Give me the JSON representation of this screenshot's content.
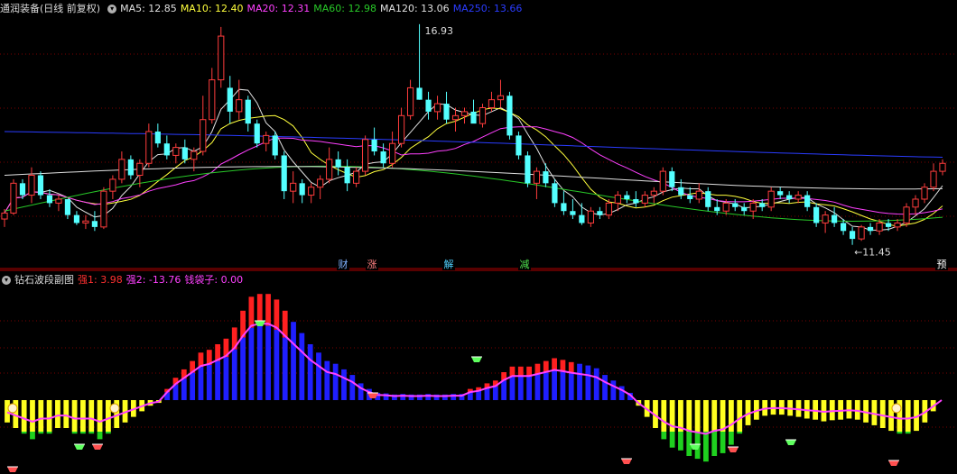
{
  "main_legend": {
    "title": "通润装备(日线 前复权)",
    "items": [
      {
        "label": "MA5: 12.85",
        "color": "#e0e0e0"
      },
      {
        "label": "MA10: 12.40",
        "color": "#ffff3c"
      },
      {
        "label": "MA20: 12.31",
        "color": "#ff40ff"
      },
      {
        "label": "MA60: 12.98",
        "color": "#28c828"
      },
      {
        "label": "MA120: 13.06",
        "color": "#e0e0e0"
      },
      {
        "label": "MA250: 13.66",
        "color": "#2a3cff"
      }
    ]
  },
  "sub_legend": {
    "title": "钻石波段副图",
    "items": [
      {
        "label": "强1: 3.98",
        "color": "#ff3030"
      },
      {
        "label": "强2: -13.76",
        "color": "#ff40ff"
      },
      {
        "label": "钱袋子: 0.00",
        "color": "#ff40ff"
      }
    ]
  },
  "markers": [
    {
      "text": "财",
      "color": "#7fb2ff"
    },
    {
      "text": "涨",
      "color": "#ff8080"
    },
    {
      "text": "解",
      "color": "#4fd0ff"
    },
    {
      "text": "减",
      "color": "#4fe04f"
    },
    {
      "text": "预",
      "color": "#ffffff"
    }
  ],
  "colors": {
    "up": "#ff3c3c",
    "down": "#54ffff",
    "grid": "#7a0000",
    "frame": "#b00000"
  },
  "chart_data": [
    {
      "type": "candlestick",
      "ylim": [
        10.9,
        17.2
      ],
      "annotations": [
        {
          "text": "16.93",
          "type": "max"
        },
        {
          "text": "←11.45",
          "type": "min"
        }
      ],
      "series": [
        {
          "name": "MA5"
        },
        {
          "name": "MA10"
        },
        {
          "name": "MA20"
        },
        {
          "name": "MA60"
        },
        {
          "name": "MA120"
        },
        {
          "name": "MA250"
        }
      ],
      "ohlc": [
        [
          12.1,
          12.35,
          11.9,
          12.25
        ],
        [
          12.25,
          13.1,
          12.2,
          13.0
        ],
        [
          13.0,
          13.1,
          12.6,
          12.7
        ],
        [
          12.7,
          13.4,
          12.5,
          13.2
        ],
        [
          13.2,
          13.3,
          12.6,
          12.7
        ],
        [
          12.7,
          12.85,
          12.4,
          12.5
        ],
        [
          12.5,
          12.7,
          12.3,
          12.6
        ],
        [
          12.6,
          12.6,
          12.1,
          12.2
        ],
        [
          12.2,
          12.3,
          11.95,
          12.0
        ],
        [
          12.0,
          12.2,
          11.85,
          12.05
        ],
        [
          12.05,
          12.3,
          11.8,
          11.9
        ],
        [
          11.9,
          12.9,
          11.85,
          12.8
        ],
        [
          12.8,
          13.2,
          12.6,
          13.1
        ],
        [
          13.1,
          13.8,
          13.0,
          13.6
        ],
        [
          13.6,
          13.7,
          13.1,
          13.2
        ],
        [
          13.2,
          13.6,
          12.9,
          13.5
        ],
        [
          13.5,
          14.5,
          13.4,
          14.3
        ],
        [
          14.3,
          14.5,
          13.9,
          14.0
        ],
        [
          14.0,
          14.2,
          13.6,
          13.7
        ],
        [
          13.7,
          14.0,
          13.5,
          13.9
        ],
        [
          13.9,
          14.1,
          13.5,
          13.6
        ],
        [
          13.6,
          13.9,
          13.3,
          13.8
        ],
        [
          13.8,
          15.2,
          13.7,
          14.6
        ],
        [
          14.6,
          15.9,
          14.5,
          15.6
        ],
        [
          15.6,
          16.93,
          15.4,
          16.7
        ],
        [
          15.4,
          15.7,
          14.5,
          14.8
        ],
        [
          14.8,
          15.6,
          14.6,
          15.1
        ],
        [
          15.1,
          15.2,
          14.3,
          14.5
        ],
        [
          14.5,
          14.6,
          13.9,
          14.0
        ],
        [
          14.0,
          14.3,
          13.8,
          14.2
        ],
        [
          14.2,
          14.3,
          13.6,
          13.7
        ],
        [
          13.7,
          13.8,
          12.6,
          12.8
        ],
        [
          12.8,
          13.3,
          12.5,
          13.0
        ],
        [
          13.0,
          13.1,
          12.5,
          12.7
        ],
        [
          12.7,
          13.0,
          12.5,
          12.9
        ],
        [
          12.9,
          13.2,
          12.6,
          13.1
        ],
        [
          13.1,
          13.9,
          13.0,
          13.6
        ],
        [
          13.6,
          13.8,
          13.2,
          13.4
        ],
        [
          13.4,
          13.6,
          12.8,
          13.0
        ],
        [
          13.0,
          13.4,
          12.9,
          13.3
        ],
        [
          13.3,
          14.2,
          13.2,
          14.1
        ],
        [
          14.1,
          14.4,
          13.7,
          13.8
        ],
        [
          13.8,
          14.0,
          13.4,
          13.5
        ],
        [
          13.5,
          14.3,
          13.4,
          14.0
        ],
        [
          14.0,
          14.9,
          13.9,
          14.7
        ],
        [
          14.7,
          15.6,
          14.6,
          15.4
        ],
        [
          15.4,
          17.0,
          15.1,
          15.1
        ],
        [
          15.1,
          15.3,
          14.6,
          14.8
        ],
        [
          14.8,
          15.2,
          14.6,
          15.0
        ],
        [
          15.0,
          15.3,
          14.5,
          14.6
        ],
        [
          14.6,
          14.9,
          14.3,
          14.7
        ],
        [
          14.7,
          14.9,
          14.5,
          14.8
        ],
        [
          14.8,
          15.1,
          14.6,
          14.5
        ],
        [
          14.5,
          15.0,
          14.4,
          14.9
        ],
        [
          14.9,
          15.3,
          14.8,
          15.1
        ],
        [
          15.1,
          15.6,
          14.9,
          15.2
        ],
        [
          15.2,
          15.3,
          14.1,
          14.2
        ],
        [
          14.2,
          14.3,
          13.6,
          13.7
        ],
        [
          13.7,
          13.8,
          12.9,
          13.0
        ],
        [
          13.0,
          13.4,
          12.6,
          13.3
        ],
        [
          13.3,
          13.5,
          12.9,
          13.0
        ],
        [
          13.0,
          13.1,
          12.4,
          12.5
        ],
        [
          12.5,
          12.8,
          12.2,
          12.3
        ],
        [
          12.3,
          12.6,
          12.1,
          12.2
        ],
        [
          12.2,
          12.5,
          11.95,
          12.0
        ],
        [
          12.0,
          12.4,
          11.9,
          12.3
        ],
        [
          12.3,
          12.4,
          12.1,
          12.2
        ],
        [
          12.2,
          12.6,
          12.1,
          12.5
        ],
        [
          12.5,
          12.8,
          12.3,
          12.7
        ],
        [
          12.7,
          12.8,
          12.5,
          12.6
        ],
        [
          12.6,
          12.8,
          12.4,
          12.5
        ],
        [
          12.5,
          12.8,
          12.4,
          12.7
        ],
        [
          12.7,
          12.9,
          12.5,
          12.8
        ],
        [
          12.8,
          13.4,
          12.7,
          13.3
        ],
        [
          13.3,
          13.4,
          12.8,
          12.9
        ],
        [
          12.9,
          13.1,
          12.6,
          12.7
        ],
        [
          12.7,
          12.9,
          12.5,
          12.6
        ],
        [
          12.6,
          13.0,
          12.5,
          12.8
        ],
        [
          12.8,
          12.9,
          12.3,
          12.4
        ],
        [
          12.4,
          12.6,
          12.2,
          12.3
        ],
        [
          12.3,
          12.6,
          12.2,
          12.5
        ],
        [
          12.5,
          12.6,
          12.3,
          12.4
        ],
        [
          12.4,
          12.5,
          12.2,
          12.3
        ],
        [
          12.3,
          12.6,
          12.1,
          12.5
        ],
        [
          12.5,
          12.6,
          12.3,
          12.4
        ],
        [
          12.4,
          12.9,
          12.3,
          12.8
        ],
        [
          12.8,
          12.9,
          12.6,
          12.7
        ],
        [
          12.7,
          12.8,
          12.5,
          12.6
        ],
        [
          12.6,
          12.8,
          12.5,
          12.7
        ],
        [
          12.7,
          12.8,
          12.3,
          12.4
        ],
        [
          12.4,
          12.5,
          11.9,
          12.0
        ],
        [
          12.0,
          12.3,
          11.75,
          12.2
        ],
        [
          12.2,
          12.4,
          11.9,
          12.0
        ],
        [
          12.0,
          12.1,
          11.7,
          11.8
        ],
        [
          11.8,
          11.9,
          11.45,
          11.6
        ],
        [
          11.6,
          11.95,
          11.55,
          11.9
        ],
        [
          11.9,
          12.0,
          11.7,
          11.8
        ],
        [
          11.8,
          12.1,
          11.7,
          12.0
        ],
        [
          12.0,
          12.1,
          11.8,
          11.9
        ],
        [
          11.9,
          12.1,
          11.8,
          12.0
        ],
        [
          12.0,
          12.5,
          11.9,
          12.4
        ],
        [
          12.4,
          12.7,
          12.2,
          12.6
        ],
        [
          12.6,
          13.0,
          12.5,
          12.9
        ],
        [
          12.9,
          13.5,
          12.8,
          13.3
        ],
        [
          13.3,
          13.6,
          13.2,
          13.5
        ]
      ]
    },
    {
      "type": "bar",
      "ylim": [
        -12,
        20
      ],
      "annotations": [
        {
          "text": "diamond"
        },
        {
          "text": "money-bag"
        }
      ],
      "series": [
        {
          "name": "强1"
        },
        {
          "name": "强2"
        },
        {
          "name": "钱袋子"
        }
      ],
      "values": [
        -4,
        -5,
        -6,
        -7,
        -6,
        -6,
        -5,
        -5,
        -6,
        -6,
        -6,
        -7,
        -6,
        -5,
        -4,
        -3,
        -2,
        -1,
        -0.5,
        2,
        4,
        5.5,
        7,
        8.5,
        9,
        10,
        11,
        13,
        16,
        18.5,
        19,
        19,
        18,
        16,
        14,
        12,
        10,
        8.5,
        7,
        6.5,
        5.5,
        4.5,
        3,
        2,
        1.3,
        1.2,
        1,
        1.1,
        1,
        1,
        1.1,
        1,
        1,
        1.1,
        1.1,
        2,
        2.3,
        3,
        3.5,
        5,
        6,
        6,
        6,
        6.5,
        7,
        7.5,
        7.2,
        6.8,
        6.5,
        6.2,
        5.7,
        4.5,
        3.5,
        2.5,
        1.3,
        -1,
        -3,
        -5,
        -7,
        -8.5,
        -9,
        -10,
        -10.5,
        -11,
        -10,
        -9.5,
        -8,
        -6,
        -4.5,
        -3.5,
        -2.8,
        -2.6,
        -2.6,
        -2.8,
        -3,
        -3.3,
        -3.5,
        -3.8,
        -3.6,
        -3.5,
        -3.3,
        -3.5,
        -4,
        -4.5,
        -5,
        -5.5,
        -6,
        -6,
        -5.5,
        -4,
        -2,
        0
      ]
    }
  ]
}
